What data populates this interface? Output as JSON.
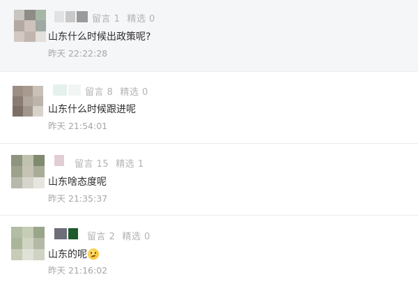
{
  "comments": [
    {
      "likes_label": "留言 1",
      "picks_label": "精选 0",
      "text": "山东什么时候出政策呢?",
      "time": "昨天 22:22:28"
    },
    {
      "likes_label": "留言 8",
      "picks_label": "精选 0",
      "text": "山东什么时候跟进呢",
      "time": "昨天 21:54:01"
    },
    {
      "likes_label": "留言 15",
      "picks_label": "精选 1",
      "text": "山东啥态度呢",
      "time": "昨天 21:35:37"
    },
    {
      "likes_label": "留言 2",
      "picks_label": "精选 0",
      "text": "山东的呢",
      "emoji": "thinking-face",
      "time": "昨天 21:16:02"
    }
  ],
  "colors": {
    "first_row_background": "#f5f6f8",
    "text": "#2d2d2d",
    "meta": "#b3b3b3"
  }
}
